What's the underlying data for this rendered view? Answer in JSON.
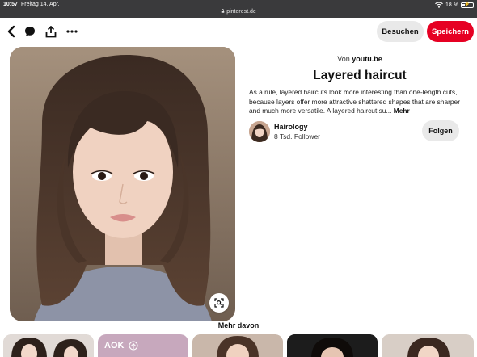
{
  "status_bar": {
    "time": "10:57",
    "date": "Freitag 14. Apr.",
    "url": "pinterest.de",
    "battery": "18 %"
  },
  "toolbar": {
    "back_icon": "chevron-left-icon",
    "comment_icon": "speech-bubble-icon",
    "share_icon": "share-upload-icon",
    "more_icon": "ellipsis-icon",
    "visit_label": "Besuchen",
    "save_label": "Speichern"
  },
  "pin": {
    "image_alt": "Portrait of a woman with layered haircut",
    "lens_icon": "visual-search-icon",
    "source_prefix": "Von",
    "source_domain": "youtu.be",
    "title": "Layered haircut",
    "description": "As a rule, layered haircuts look more interesting than one-length cuts, because layers offer more attractive shattered shapes that are sharper and much more versatile. A layered haircut su...",
    "more_label": "Mehr",
    "creator": {
      "name": "Hairology",
      "followers": "8 Tsd. Follower",
      "follow_label": "Folgen"
    }
  },
  "related": {
    "heading": "Mehr davon",
    "thumb_2_text": "AOK"
  },
  "colors": {
    "brand_red": "#e60023",
    "pill_gray": "#e9e9e9",
    "statusbar": "#3a3a3c"
  }
}
